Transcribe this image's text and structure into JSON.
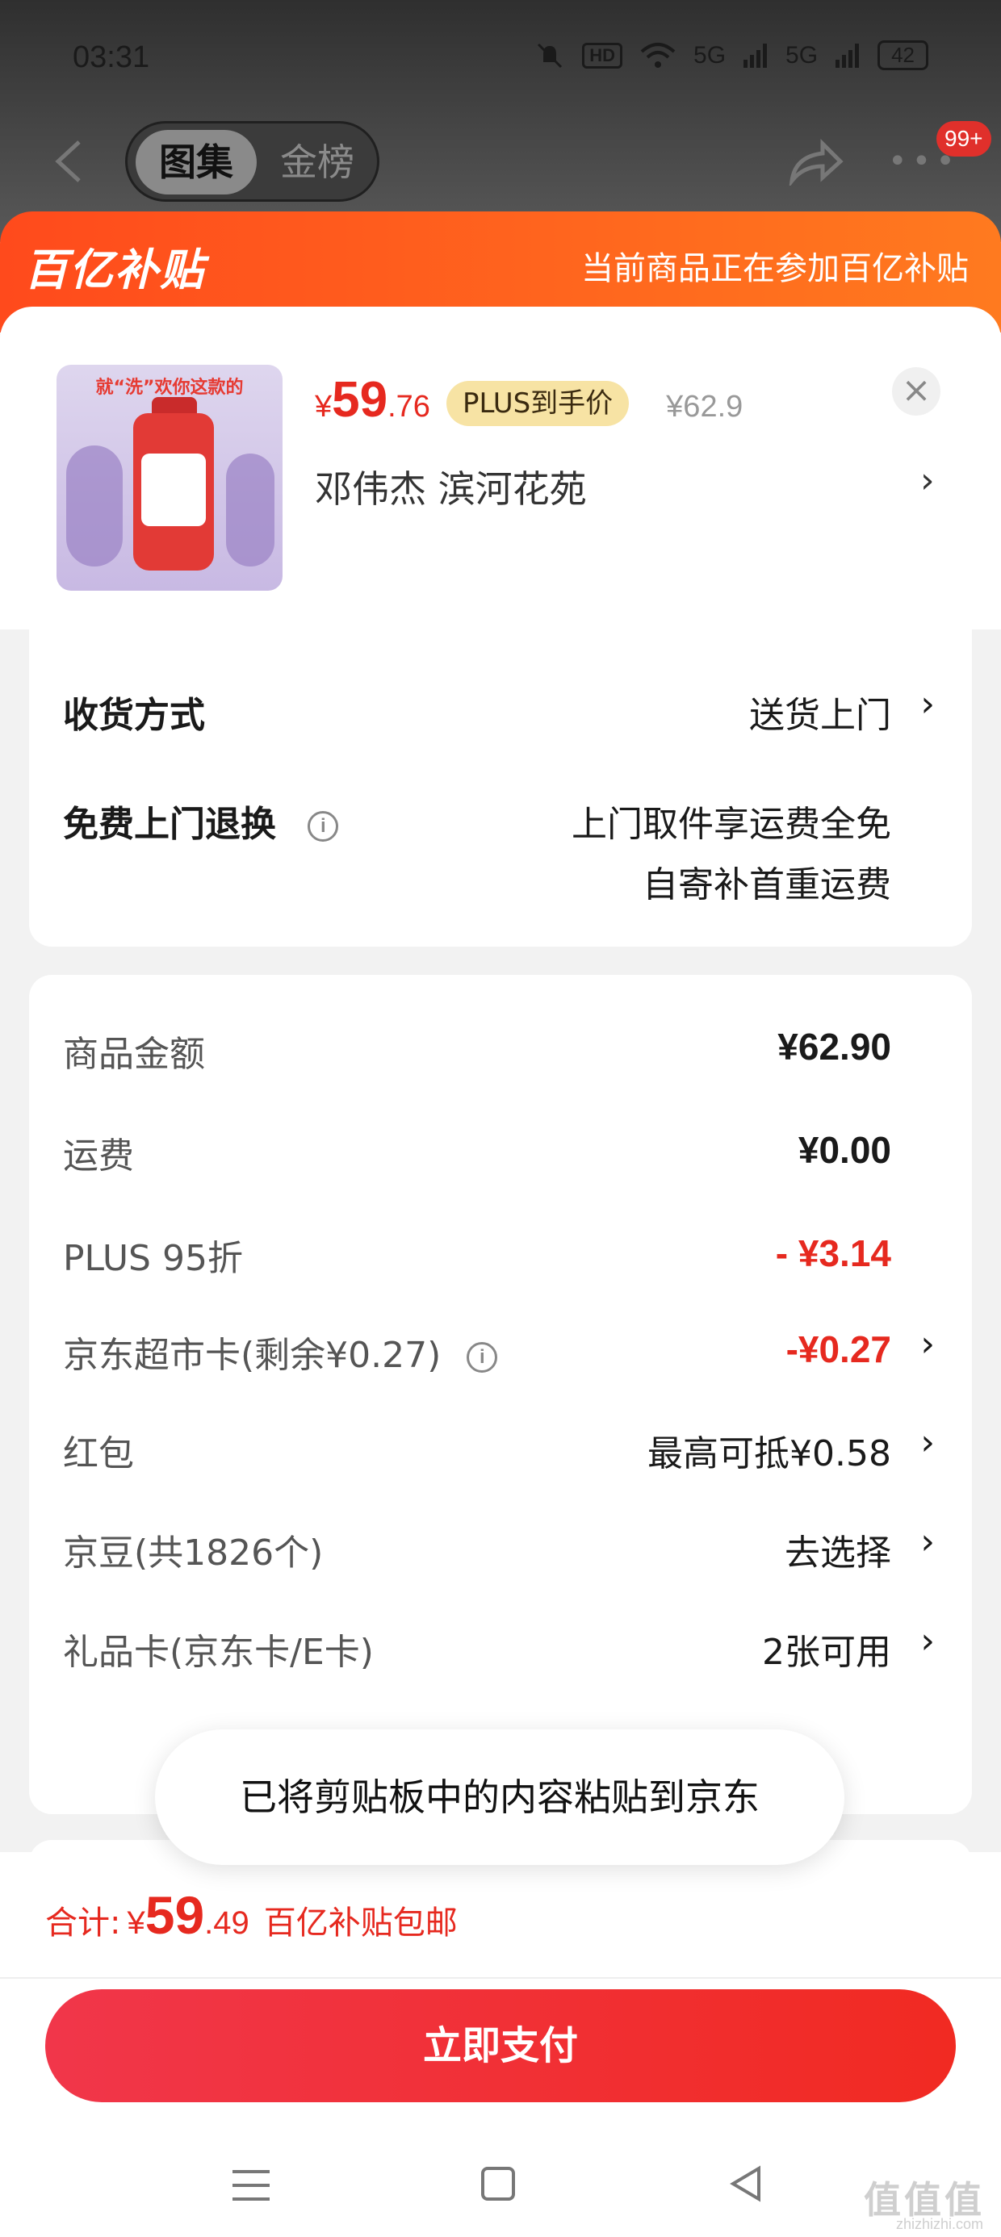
{
  "status_bar": {
    "time": "03:31",
    "hd_label": "HD",
    "network_labels": [
      "5G",
      "5G"
    ],
    "battery": "42"
  },
  "nav": {
    "tabs": [
      "图集",
      "金榜"
    ],
    "active_tab": "图集",
    "badge": "99+"
  },
  "subsidy": {
    "logo": "百亿补贴",
    "message": "当前商品正在参加百亿补贴"
  },
  "product": {
    "image_slogan": "就“洗”欢你这款的",
    "price_symbol": "¥",
    "price_int": "59",
    "price_dec": ".76",
    "plus_tag": "PLUS到手价",
    "original_price": "¥62.9",
    "address": "邓伟杰  滨河花苑",
    "close_glyph": "×",
    "chevron": "›"
  },
  "delivery": {
    "method_label": "收货方式",
    "method_value": "送货上门",
    "return_label": "免费上门退换",
    "return_value_1": "上门取件享运费全免",
    "return_value_2": "自寄补首重运费"
  },
  "summary": {
    "items": [
      {
        "label": "商品金额",
        "value": "¥62.90"
      },
      {
        "label": "运费",
        "value": "¥0.00"
      },
      {
        "label": "PLUS 95折",
        "value": "- ¥3.14"
      },
      {
        "label": "京东超市卡(剩余¥0.27)",
        "value": "-¥0.27"
      },
      {
        "label": "红包",
        "value": "最高可抵¥0.58"
      },
      {
        "label": "京豆(共1826个)",
        "value": "去选择"
      },
      {
        "label": "礼品卡(京东卡/E卡)",
        "value": "2张可用"
      }
    ]
  },
  "toast": "已将剪贴板中的内容粘贴到京东",
  "checkout": {
    "total_label": "合计:",
    "total_symbol": "¥",
    "total_int": "59",
    "total_dec": ".49",
    "total_note": "百亿补贴包邮",
    "pay_button": "立即支付"
  },
  "watermark": "值值值",
  "watermark_sub": "zhizhizhi.com",
  "colors": {
    "accent_red": "#e6291f",
    "subsidy_orange": "#ff5a1e",
    "plus_gold": "#f7e3a4"
  },
  "icons": [
    "back-icon",
    "share-icon",
    "more-icon",
    "close-icon",
    "info-icon",
    "chevron-right-icon",
    "menu-icon",
    "home-icon",
    "nav-back-icon"
  ]
}
